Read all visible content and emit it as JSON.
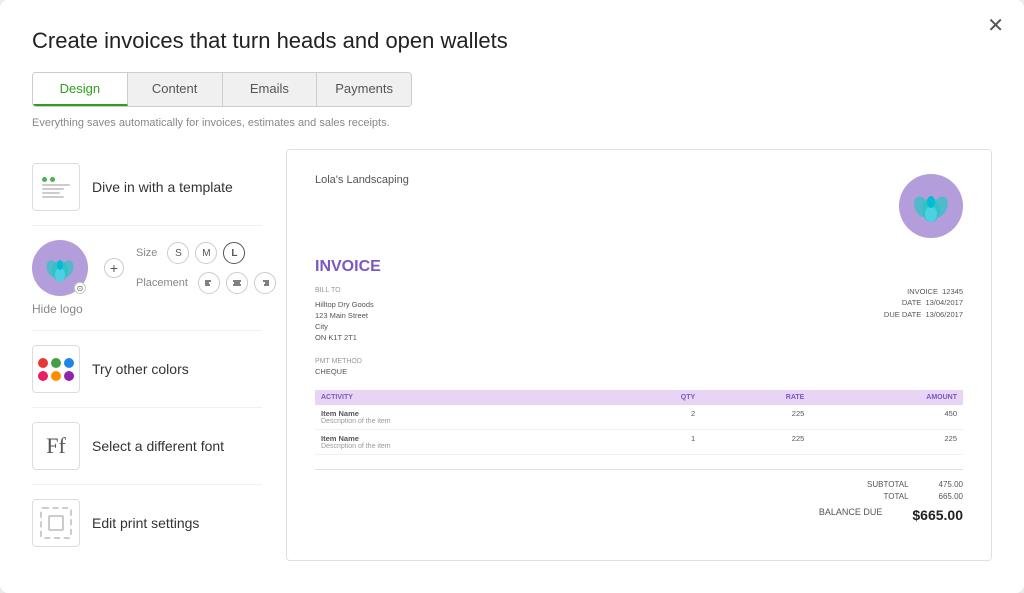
{
  "modal": {
    "title": "Create invoices that turn heads and open wallets",
    "close_label": "✕"
  },
  "tabs": [
    {
      "id": "design",
      "label": "Design",
      "active": true
    },
    {
      "id": "content",
      "label": "Content",
      "active": false
    },
    {
      "id": "emails",
      "label": "Emails",
      "active": false
    },
    {
      "id": "payments",
      "label": "Payments",
      "active": false
    }
  ],
  "auto_save": "Everything saves automatically for invoices, estimates and sales receipts.",
  "sections": {
    "template": {
      "label": "Dive in with a template"
    },
    "colors": {
      "label": "Try other colors"
    },
    "font": {
      "label": "Select a different font"
    },
    "print": {
      "label": "Edit print settings"
    }
  },
  "logo": {
    "hide_label": "Hide logo",
    "size_label": "Size",
    "sizes": [
      "S",
      "M",
      "L"
    ],
    "active_size": "L",
    "placement_label": "Placement"
  },
  "colors": {
    "dots": [
      "#e53935",
      "#43a047",
      "#1e88e5",
      "#e91e63",
      "#fb8c00",
      "#8e24aa"
    ]
  },
  "invoice": {
    "company": "Lola's Landscaping",
    "title": "INVOICE",
    "bill_to_label": "BILL TO",
    "bill_to": "Hilltop Dry Goods\n123 Main Street\nCity\nON K1T 2T1",
    "invoice_num_label": "INVOICE",
    "invoice_num": "12345",
    "date_label": "DATE",
    "date": "13/04/2017",
    "due_date_label": "DUE DATE",
    "due_date": "13/06/2017",
    "pmt_method_label": "PMT METHOD",
    "pmt_method": "CHEQUE",
    "table_headers": [
      "ACTIVITY",
      "QTY",
      "RATE",
      "AMOUNT"
    ],
    "line_items": [
      {
        "name": "Item Name",
        "desc": "Description of the item",
        "qty": "2",
        "rate": "225",
        "amount": "450"
      },
      {
        "name": "Item Name",
        "desc": "Description of the item",
        "qty": "1",
        "rate": "225",
        "amount": "225"
      }
    ],
    "subtotal_label": "SUBTOTAL",
    "subtotal": "475.00",
    "total_label": "TOTAL",
    "total": "665.00",
    "balance_due_label": "BALANCE DUE",
    "balance_due": "$665.00"
  }
}
